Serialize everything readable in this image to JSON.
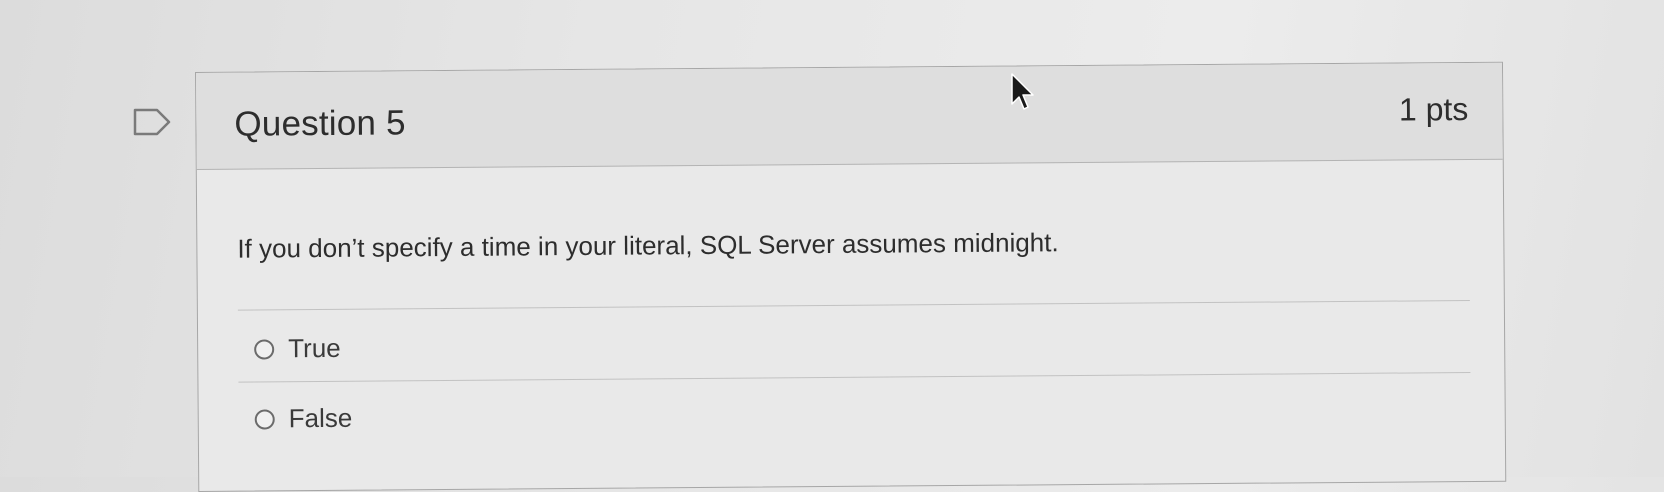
{
  "question": {
    "title": "Question 5",
    "points": "1 pts",
    "text": "If you don’t specify a time in your literal, SQL Server assumes midnight.",
    "answers": [
      {
        "label": "True",
        "selected": false
      },
      {
        "label": "False",
        "selected": false
      }
    ]
  },
  "icons": {
    "flag": "flag-outline-icon",
    "cursor": "mouse-pointer-icon"
  },
  "colors": {
    "card_background": "#e9e9e9",
    "header_background": "#dedede",
    "border": "#a6a6a6",
    "text": "#2d2d2d"
  }
}
